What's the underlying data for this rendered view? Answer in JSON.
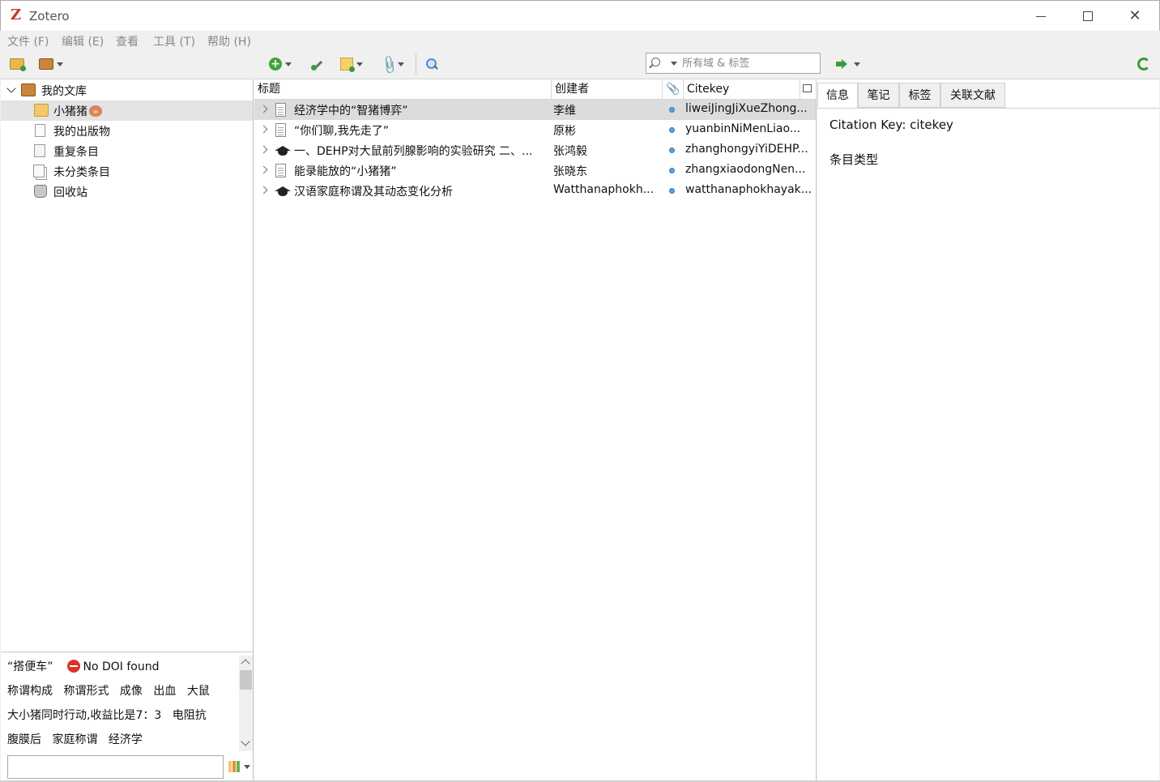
{
  "window": {
    "app_icon": "Z",
    "title": "Zotero"
  },
  "menu": [
    "文件 (F)",
    "编辑 (E)",
    "查看",
    "工具 (T)",
    "帮助 (H)"
  ],
  "toolbar": {
    "search_placeholder": "所有域 & 标签"
  },
  "collections": {
    "library": "我的文库",
    "items": [
      "小猪猪",
      "我的出版物",
      "重复条目",
      "未分类条目",
      "回收站"
    ]
  },
  "items_table": {
    "columns": {
      "title": "标题",
      "creator": "创建者",
      "citekey": "Citekey"
    },
    "rows": [
      {
        "type": "journal-article",
        "title": "经济学中的“智猪博弈”",
        "creator": "李维",
        "citekey": "liweiJingJiXueZhong..."
      },
      {
        "type": "journal-article",
        "title": "“你们聊,我先走了”",
        "creator": "原彬",
        "citekey": "yuanbinNiMenLiao..."
      },
      {
        "type": "thesis",
        "title": "一、DEHP对大鼠前列腺影响的实验研究 二、...",
        "creator": "张鸿毅",
        "citekey": "zhanghongyiYiDEHP..."
      },
      {
        "type": "journal-article",
        "title": "能录能放的“小猪猪”",
        "creator": "张晓东",
        "citekey": "zhangxiaodongNen..."
      },
      {
        "type": "thesis",
        "title": "汉语家庭称谓及其动态变化分析",
        "creator": "Watthanaphokh...",
        "citekey": "watthanaphokhayak..."
      }
    ]
  },
  "tags": {
    "line1": {
      "tag": "“搭便车”",
      "badge": "No DOI found"
    },
    "line2": [
      "称谓构成",
      "称谓形式",
      "成像",
      "出血",
      "大鼠"
    ],
    "line3": [
      "大小猪同时行动,收益比是7：3",
      "电阻抗"
    ],
    "line4": [
      "腹膜后",
      "家庭称谓",
      "经济学"
    ]
  },
  "item_pane": {
    "tabs": [
      "信息",
      "笔记",
      "标签",
      "关联文献"
    ],
    "citation_key": "Citation Key: citekey",
    "item_type_label": "条目类型"
  }
}
